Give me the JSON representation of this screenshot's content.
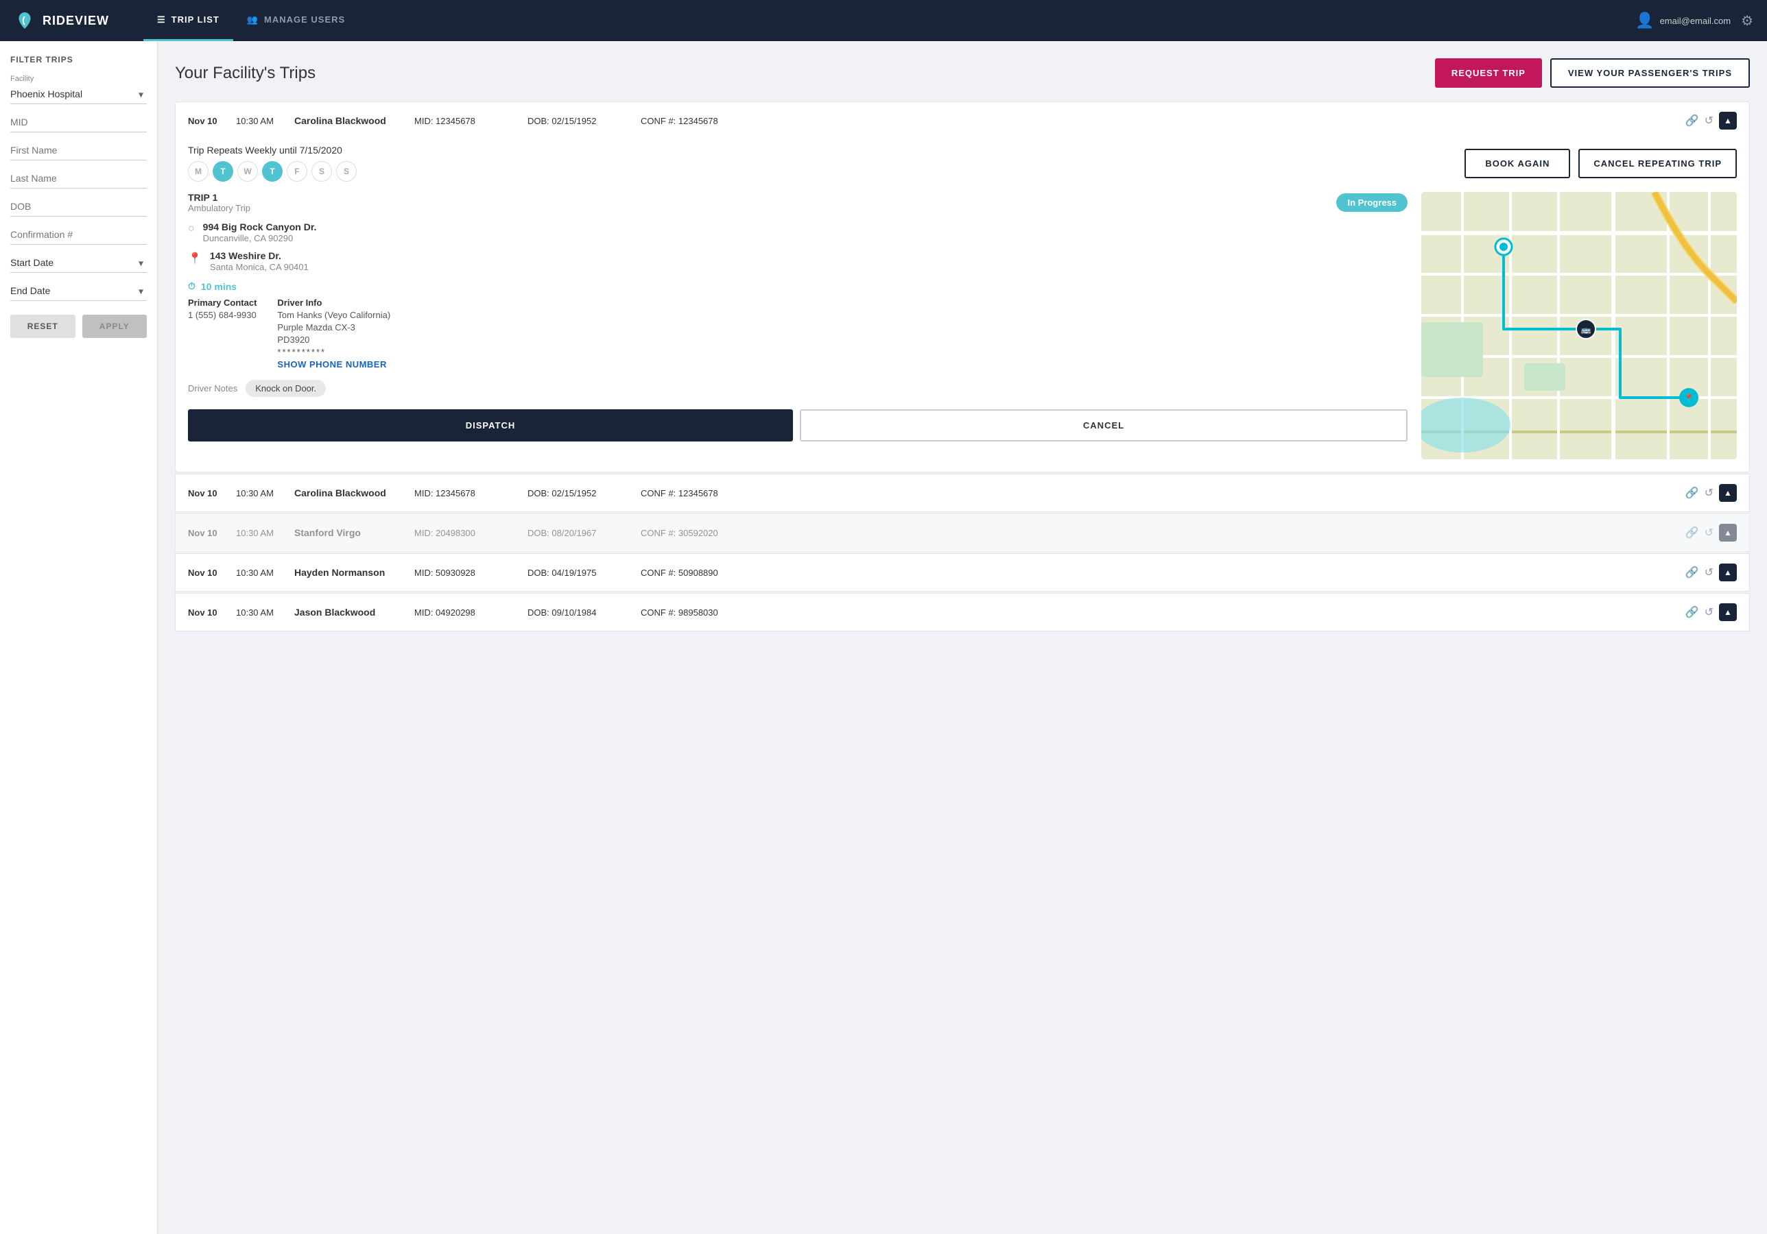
{
  "app": {
    "brand": "RIDEVIEW",
    "logo_icon": "leaf"
  },
  "navbar": {
    "trip_list_label": "TRIP LIST",
    "manage_users_label": "MANAGE USERS",
    "user_email": "email@email.com"
  },
  "sidebar": {
    "title": "FILTER TRIPS",
    "facility_label": "Facility",
    "facility_value": "Phoenix Hospital",
    "mid_placeholder": "MID",
    "first_name_placeholder": "First Name",
    "last_name_placeholder": "Last Name",
    "dob_placeholder": "DOB",
    "confirmation_placeholder": "Confirmation #",
    "start_date_placeholder": "Start Date",
    "end_date_placeholder": "End Date",
    "reset_label": "RESET",
    "apply_label": "APPLY"
  },
  "main": {
    "title": "Your Facility's Trips",
    "request_trip_label": "REQUEST TRIP",
    "view_passenger_label": "VIEW YOUR PASSENGER'S TRIPS"
  },
  "expanded_trip": {
    "repeating_text": "Trip Repeats Weekly until 7/15/2020",
    "days": [
      {
        "label": "M",
        "active": false
      },
      {
        "label": "T",
        "active": true
      },
      {
        "label": "W",
        "active": false
      },
      {
        "label": "T",
        "active": true
      },
      {
        "label": "F",
        "active": false
      },
      {
        "label": "S",
        "active": false
      },
      {
        "label": "S",
        "active": false
      }
    ],
    "book_again_label": "BOOK AGAIN",
    "cancel_repeating_label": "CANCEL REPEATING TRIP",
    "trip_number": "TRIP 1",
    "trip_type": "Ambulatory Trip",
    "status": "In Progress",
    "pickup_address": "994 Big Rock Canyon Dr.",
    "pickup_city": "Duncanville, CA 90290",
    "dropoff_address": "143 Weshire Dr.",
    "dropoff_city": "Santa Monica, CA 90401",
    "duration": "10 mins",
    "primary_contact_label": "Primary Contact",
    "primary_contact_value": "1 (555) 684-9930",
    "driver_info_label": "Driver Info",
    "driver_name": "Tom Hanks (Veyo California)",
    "driver_vehicle": "Purple Mazda CX-3",
    "driver_plate": "PD3920",
    "driver_phone_masked": "**********",
    "show_phone_label": "SHOW PHONE NUMBER",
    "driver_notes_label": "Driver Notes",
    "driver_notes_value": "Knock on Door.",
    "dispatch_label": "DISPATCH",
    "cancel_label": "CANCEL"
  },
  "trip_rows": [
    {
      "date": "Nov 10",
      "time": "10:30 AM",
      "name": "Carolina Blackwood",
      "mid": "MID: 12345678",
      "dob": "DOB: 02/15/1952",
      "conf": "CONF #: 12345678",
      "dimmed": false,
      "active": true
    },
    {
      "date": "Nov 10",
      "time": "10:30 AM",
      "name": "Carolina Blackwood",
      "mid": "MID: 12345678",
      "dob": "DOB: 02/15/1952",
      "conf": "CONF #: 12345678",
      "dimmed": false,
      "active": false
    },
    {
      "date": "Nov 10",
      "time": "10:30 AM",
      "name": "Stanford Virgo",
      "mid": "MID: 20498300",
      "dob": "DOB: 08/20/1967",
      "conf": "CONF #: 30592020",
      "dimmed": true,
      "active": false
    },
    {
      "date": "Nov 10",
      "time": "10:30 AM",
      "name": "Hayden Normanson",
      "mid": "MID: 50930928",
      "dob": "DOB: 04/19/1975",
      "conf": "CONF #: 50908890",
      "dimmed": false,
      "active": false
    },
    {
      "date": "Nov 10",
      "time": "10:30 AM",
      "name": "Jason Blackwood",
      "mid": "MID: 04920298",
      "dob": "DOB: 09/10/1984",
      "conf": "CONF #: 98958030",
      "dimmed": false,
      "active": false
    }
  ]
}
